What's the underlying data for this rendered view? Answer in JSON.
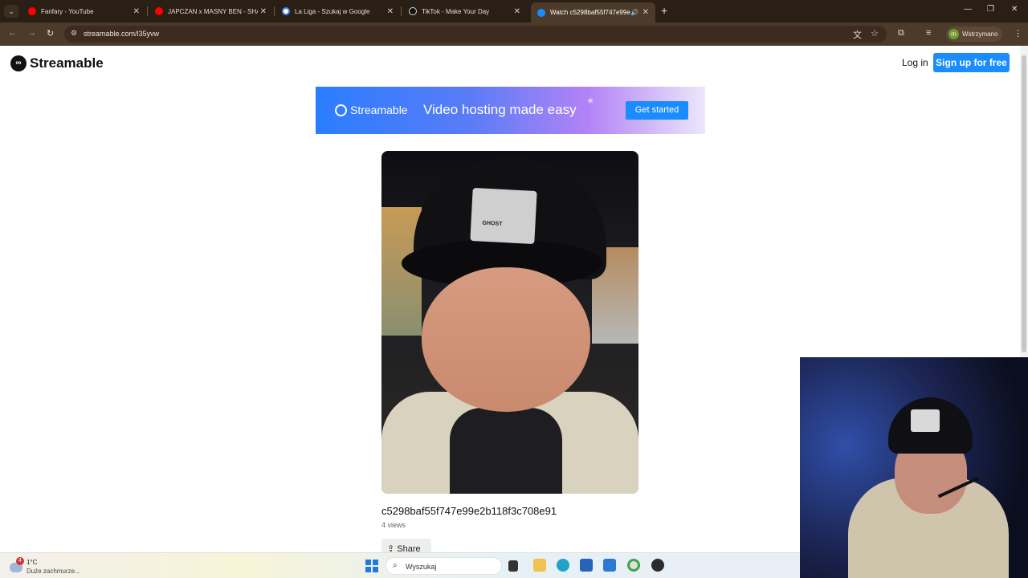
{
  "browser": {
    "tabs": [
      {
        "title": "Fanfary - YouTube",
        "favicon": "youtube-icon",
        "color": "#ff0000",
        "active": false
      },
      {
        "title": "JAPCZAN x MASNY BEN - SHAI",
        "favicon": "youtube-icon",
        "color": "#ff0000",
        "active": false
      },
      {
        "title": "La Liga - Szukaj w Google",
        "favicon": "google-icon",
        "color": "#4285f4",
        "active": false
      },
      {
        "title": "TikTok - Make Your Day",
        "favicon": "tiktok-icon",
        "color": "#111111",
        "active": false
      },
      {
        "title": "Watch c5298baf55f747e99e",
        "favicon": "streamable-icon",
        "color": "#1a8cff",
        "active": true
      }
    ],
    "url": "streamable.com/l35yvw",
    "profile_label": "Wstrzymano",
    "profile_initial": "m"
  },
  "site": {
    "logo_text": "Streamable",
    "login_label": "Log in",
    "signup_label": "Sign up for free"
  },
  "banner": {
    "brand": "Streamable",
    "tagline": "Video hosting made easy",
    "cta": "Get started"
  },
  "video": {
    "cap_patch_text": "GHOST",
    "title": "c5298baf55f747e99e2b118f3c708e91",
    "views": "4 views",
    "share_label": "Share"
  },
  "taskbar": {
    "temperature": "1°C",
    "weather": "Duże zachmurze...",
    "weather_badge": "4",
    "search_placeholder": "Wyszukaj"
  }
}
